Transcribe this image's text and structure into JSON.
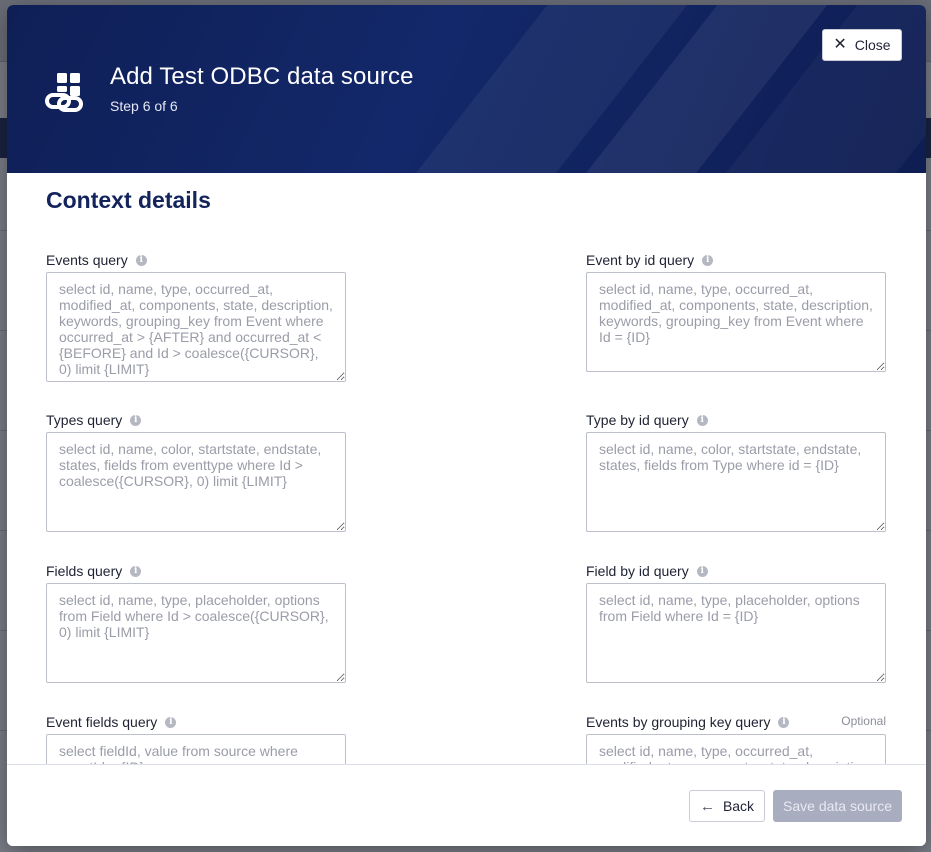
{
  "colors": {
    "header_bg": "#13286a",
    "section_title": "#13235c",
    "save_disabled_bg": "#a9adc0"
  },
  "header": {
    "icon": "data-source-link-icon",
    "title": "Add Test ODBC data source",
    "step": "Step 6 of 6",
    "close_label": "Close",
    "close_icon": "close-icon"
  },
  "body": {
    "section_title": "Context details",
    "fields": {
      "events_query": {
        "label": "Events query",
        "placeholder": "select id, name, type, occurred_at, modified_at, components, state, description, keywords, grouping_key from Event where occurred_at > {AFTER} and occurred_at < {BEFORE} and Id > coalesce({CURSOR}, 0) limit {LIMIT}"
      },
      "event_by_id_query": {
        "label": "Event by id query",
        "placeholder": "select id, name, type, occurred_at, modified_at, components, state, description, keywords, grouping_key from Event where Id = {ID}"
      },
      "types_query": {
        "label": "Types query",
        "placeholder": "select id, name, color, startstate, endstate, states, fields from eventtype where Id > coalesce({CURSOR}, 0) limit {LIMIT}"
      },
      "type_by_id_query": {
        "label": "Type by id query",
        "placeholder": "select id, name, color, startstate, endstate, states, fields from Type where id = {ID}"
      },
      "fields_query": {
        "label": "Fields query",
        "placeholder": "select id, name, type, placeholder, options from Field where Id > coalesce({CURSOR}, 0) limit {LIMIT}"
      },
      "field_by_id_query": {
        "label": "Field by id query",
        "placeholder": "select id, name, type, placeholder, options from Field where Id = {ID}"
      },
      "event_fields_query": {
        "label": "Event fields query",
        "placeholder": "select fieldId, value from source where eventId = {ID}"
      },
      "events_by_grouping_key_query": {
        "label": "Events by grouping key query",
        "optional": "Optional",
        "placeholder": "select id, name, type, occurred_at, modified_at, components, state, description, keywords, grouping_key from Event where grouping_key = {KEY}"
      }
    }
  },
  "footer": {
    "back_label": "Back",
    "back_icon": "arrow-left-icon",
    "save_label": "Save data source"
  }
}
